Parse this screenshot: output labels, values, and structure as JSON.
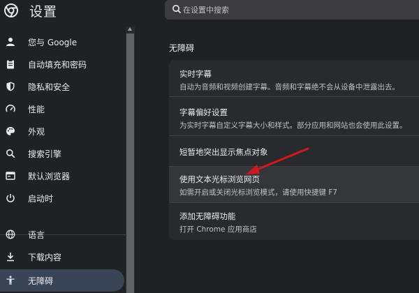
{
  "header": {
    "title": "设置",
    "search_placeholder": "在设置中搜索"
  },
  "sidebar": {
    "items": [
      {
        "label": "您与 Google",
        "icon": "person-icon"
      },
      {
        "label": "自动填充和密码",
        "icon": "clipboard-icon"
      },
      {
        "label": "隐私和安全",
        "icon": "shield-icon"
      },
      {
        "label": "性能",
        "icon": "speedometer-icon"
      },
      {
        "label": "外观",
        "icon": "palette-icon"
      },
      {
        "label": "搜索引擎",
        "icon": "search-icon"
      },
      {
        "label": "默认浏览器",
        "icon": "browser-icon"
      },
      {
        "label": "启动时",
        "icon": "power-icon"
      },
      {
        "label": "语言",
        "icon": "globe-icon"
      },
      {
        "label": "下载内容",
        "icon": "download-icon"
      },
      {
        "label": "无障碍",
        "icon": "accessibility-icon",
        "active": true
      }
    ]
  },
  "main": {
    "section_title": "无障碍",
    "rows": [
      {
        "title": "实时字幕",
        "subtitle": "自动为音频和视频创建字幕。音频和字幕绝不会从设备中泄露出去。"
      },
      {
        "title": "字幕偏好设置",
        "subtitle": "为实时字幕自定义字幕大小和样式。部分应用和网站也会使用此设置。"
      },
      {
        "title": "短暂地突出显示焦点对象",
        "subtitle": ""
      },
      {
        "title": "使用文本光标浏览网页",
        "subtitle": "如需开启或关闭光标浏览模式，请使用快捷键 F7"
      },
      {
        "title": "添加无障碍功能",
        "subtitle": "打开 Chrome 应用商店"
      }
    ]
  },
  "colors": {
    "background": "#202124",
    "card": "#292a2d",
    "active_item": "#394457",
    "annotation_arrow": "#d0191f"
  }
}
